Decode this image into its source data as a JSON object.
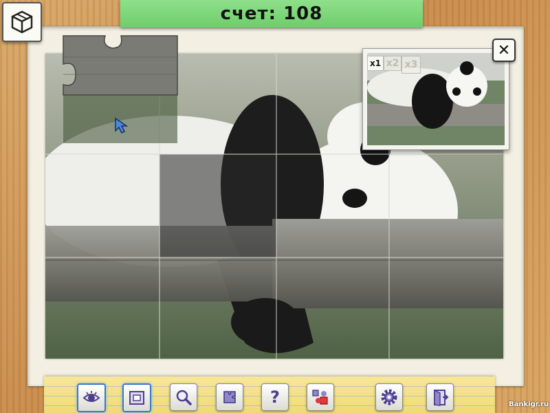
{
  "score": {
    "label": "счет: 108"
  },
  "preview": {
    "zoom_options": [
      "x1",
      "x2",
      "x3"
    ],
    "selected_zoom": "x1"
  },
  "toolbar": {
    "tools": [
      {
        "name": "eye-icon",
        "active": true
      },
      {
        "name": "frame-icon",
        "active": true
      },
      {
        "name": "magnifier-icon",
        "active": false
      },
      {
        "name": "puzzle-pieces-icon",
        "active": false
      },
      {
        "name": "help-icon",
        "active": false,
        "glyph": "?"
      },
      {
        "name": "puzzle-shuffle-icon",
        "active": false
      },
      {
        "name": "settings-gear-icon",
        "active": false
      },
      {
        "name": "exit-door-icon",
        "active": false
      }
    ]
  },
  "watermark": "Bankigr.ru",
  "colors": {
    "score_tab": "#7dd67a",
    "toolbar": "#f4e07f",
    "active_tool_border": "#3a78c8",
    "paper": "#f3efe2",
    "wood": "#d09a57"
  }
}
